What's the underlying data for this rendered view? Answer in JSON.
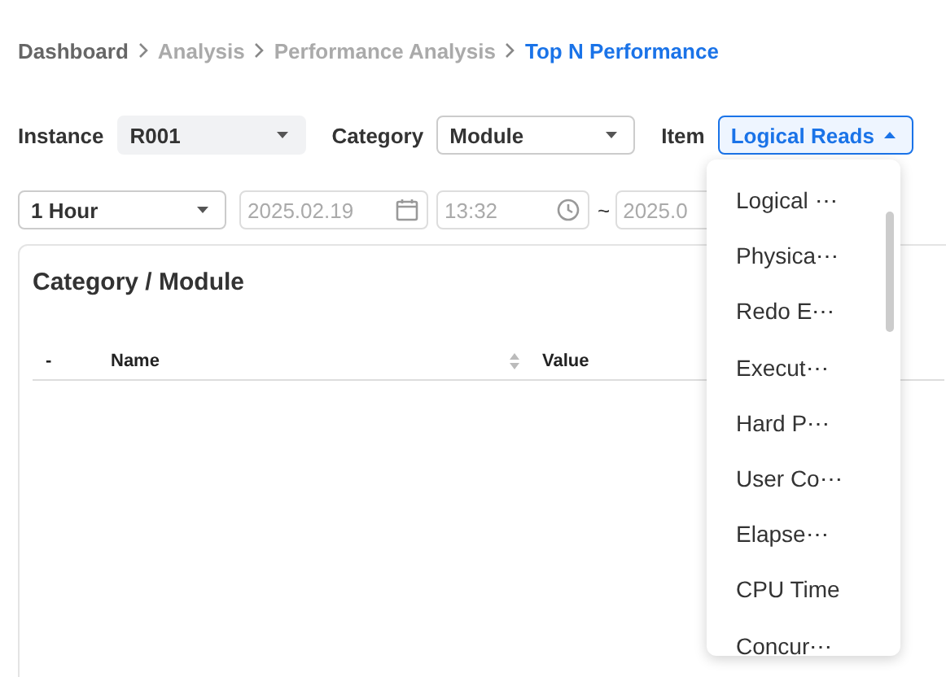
{
  "breadcrumb": [
    {
      "label": "Dashboard",
      "kind": "root"
    },
    {
      "label": "Analysis",
      "kind": "link"
    },
    {
      "label": "Performance Analysis",
      "kind": "link"
    },
    {
      "label": "Top N Performance",
      "kind": "current"
    }
  ],
  "filters": [
    {
      "label": "Instance",
      "value": "R001",
      "kind": "filled",
      "open": false
    },
    {
      "label": "Category",
      "value": "Module",
      "kind": "outlined",
      "open": false
    },
    {
      "label": "Item",
      "value": "Logical Reads",
      "kind": "outlined",
      "open": true
    }
  ],
  "range": {
    "period": "1 Hour",
    "start_date": "2025.02.19",
    "start_time": "13:32",
    "separator": "~",
    "end_date": "2025.0"
  },
  "menu": {
    "items": [
      {
        "label": "Logical ⋯"
      },
      {
        "label": "Physica⋯"
      },
      {
        "label": "Redo E⋯"
      },
      {
        "label": "Execut⋯"
      },
      {
        "label": "Hard P⋯"
      },
      {
        "label": "User Co⋯"
      },
      {
        "label": "Elapse⋯"
      },
      {
        "label": "CPU Time"
      },
      {
        "label": "Concur⋯"
      }
    ]
  },
  "card": {
    "title": "Category / Module",
    "columns": [
      {
        "label": "-",
        "sortable": false
      },
      {
        "label": "Name",
        "sortable": true
      },
      {
        "label": "Value",
        "sortable": false
      }
    ]
  }
}
